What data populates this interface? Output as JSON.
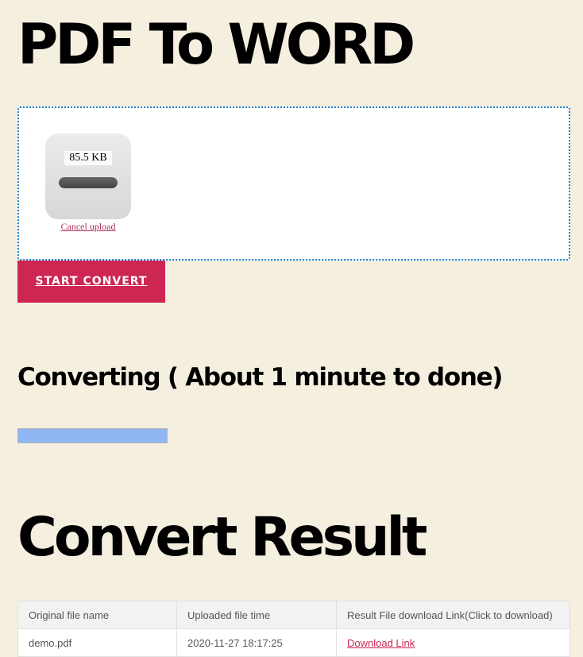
{
  "page_title": "PDF To WORD",
  "upload": {
    "file_size": "85.5 KB",
    "progress": 1.0,
    "cancel_label": "Cancel upload"
  },
  "start_button_label": "START CONVERT",
  "converting": {
    "heading": "Converting ( About 1 minute to done)",
    "progress": 1.0
  },
  "result": {
    "heading": "Convert Result",
    "columns": [
      "Original file name",
      "Uploaded file time",
      "Result File download Link(Click to download)"
    ],
    "rows": [
      {
        "file_name": "demo.pdf",
        "uploaded_time": "2020-11-27 18:17:25",
        "link_label": "Download Link"
      }
    ]
  },
  "colors": {
    "background": "#f5efe0",
    "accent": "#cd2653",
    "dropzone_border": "#1a7fc9",
    "progress_fill": "#8fb6f2"
  }
}
